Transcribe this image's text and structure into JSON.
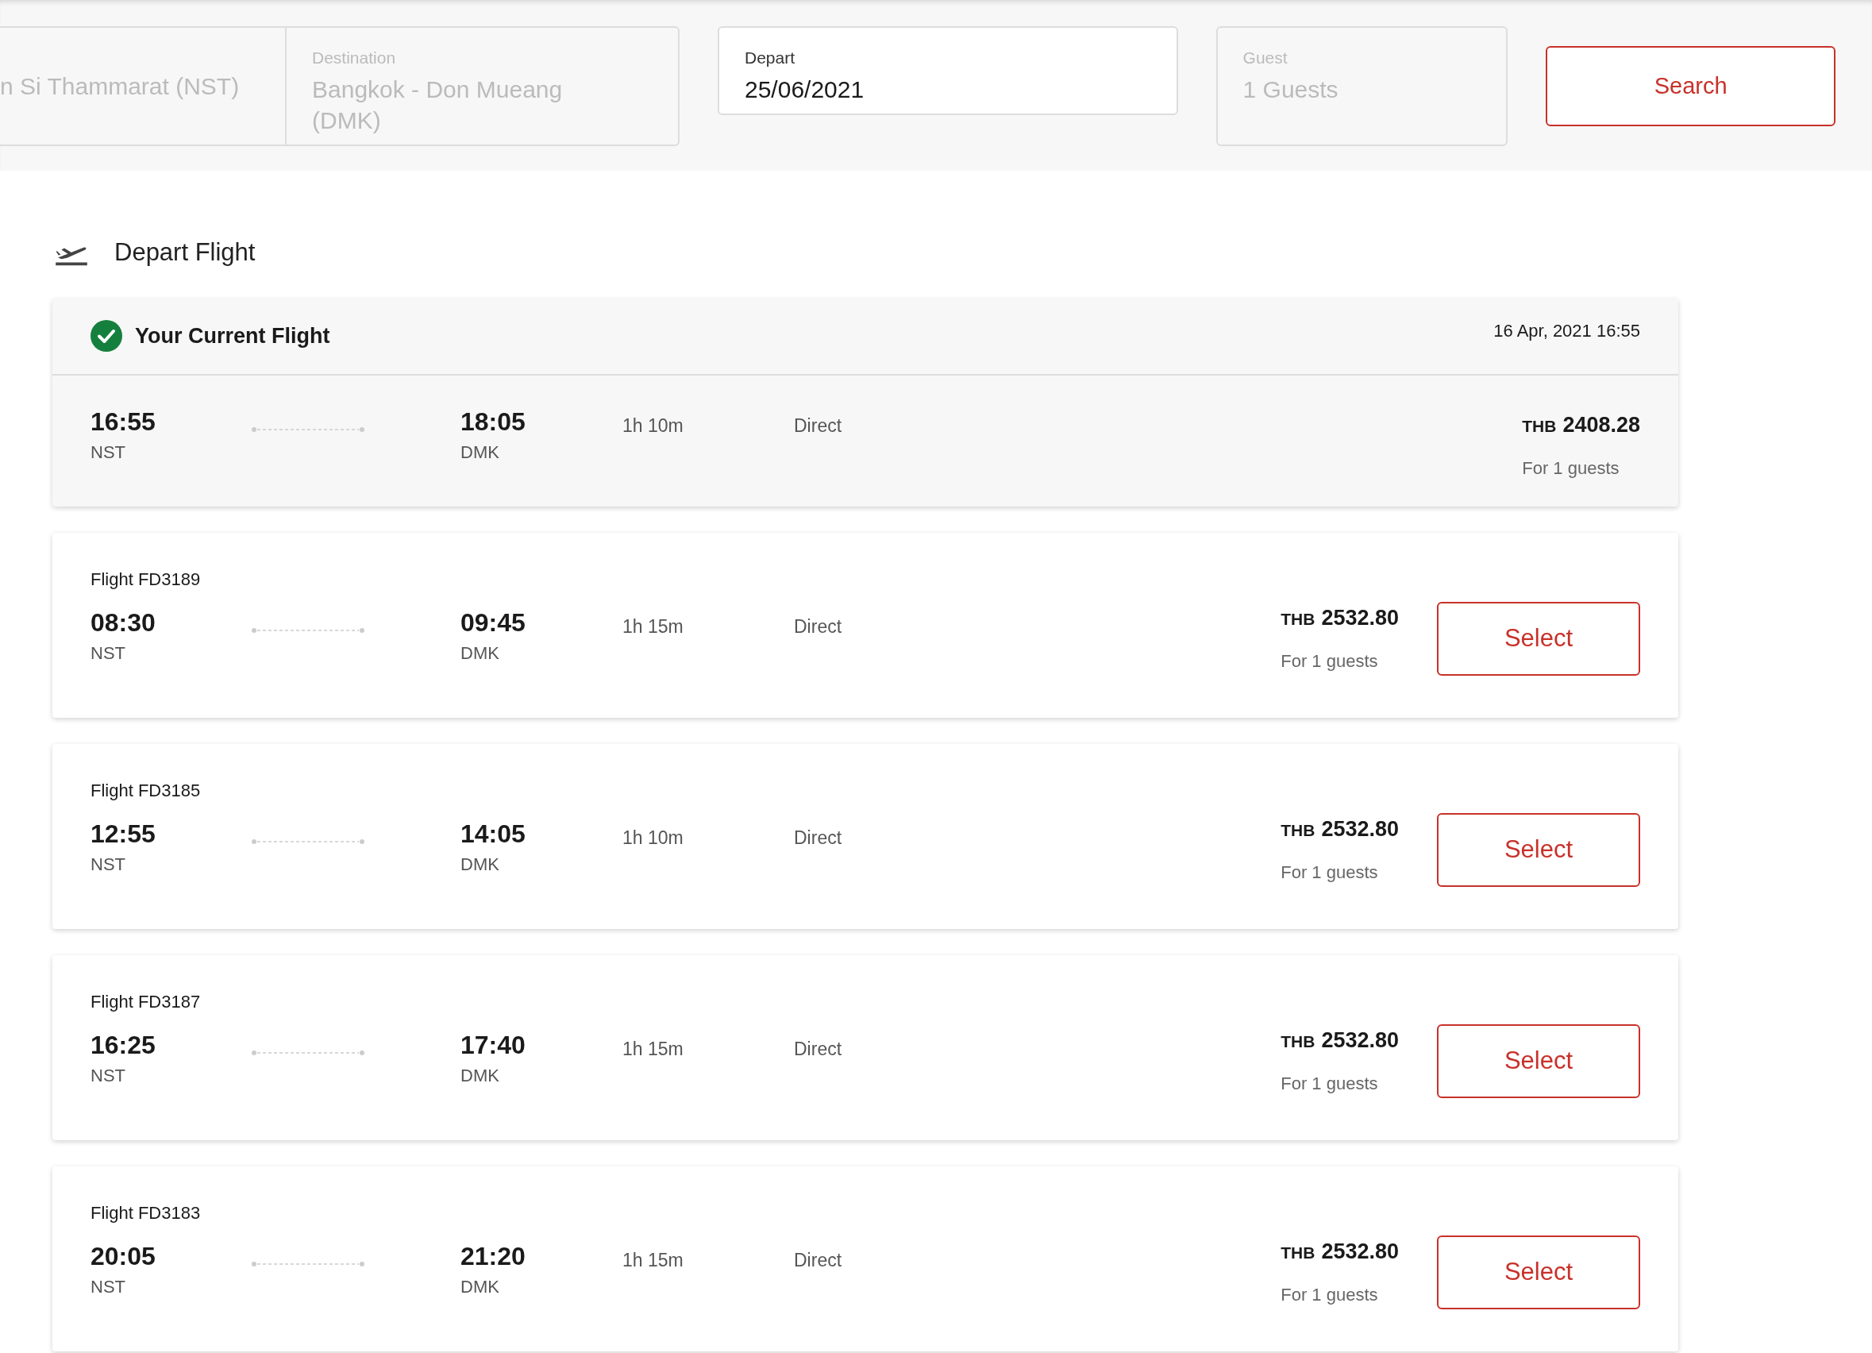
{
  "search_bar": {
    "fields": [
      {
        "kind": "cut",
        "value": "n Si Thammarat (NST)",
        "disabled": true
      },
      {
        "kind": "labeled",
        "label": "Destination",
        "value": "Bangkok - Don Mueang (DMK)",
        "disabled": true
      },
      {
        "kind": "labeled",
        "label": "Depart",
        "value": "25/06/2021",
        "disabled": false
      },
      {
        "kind": "labeled",
        "label": "Guest",
        "value": "1 Guests",
        "disabled": true
      }
    ],
    "search_button": "Search"
  },
  "section_title": "Depart Flight",
  "current_flight": {
    "title": "Your Current Flight",
    "booked_at": "16 Apr, 2021 16:55",
    "depart_time": "16:55",
    "depart_code": "NST",
    "arrive_time": "18:05",
    "arrive_code": "DMK",
    "duration": "1h 10m",
    "stops": "Direct",
    "currency": "THB",
    "price": "2408.28",
    "guests": "For 1 guests"
  },
  "flights": [
    {
      "flight_no": "Flight FD3189",
      "depart_time": "08:30",
      "depart_code": "NST",
      "arrive_time": "09:45",
      "arrive_code": "DMK",
      "duration": "1h 15m",
      "stops": "Direct",
      "currency": "THB",
      "price": "2532.80",
      "guests": "For 1 guests",
      "button": "Select"
    },
    {
      "flight_no": "Flight FD3185",
      "depart_time": "12:55",
      "depart_code": "NST",
      "arrive_time": "14:05",
      "arrive_code": "DMK",
      "duration": "1h 10m",
      "stops": "Direct",
      "currency": "THB",
      "price": "2532.80",
      "guests": "For 1 guests",
      "button": "Select"
    },
    {
      "flight_no": "Flight FD3187",
      "depart_time": "16:25",
      "depart_code": "NST",
      "arrive_time": "17:40",
      "arrive_code": "DMK",
      "duration": "1h 15m",
      "stops": "Direct",
      "currency": "THB",
      "price": "2532.80",
      "guests": "For 1 guests",
      "button": "Select"
    },
    {
      "flight_no": "Flight FD3183",
      "depart_time": "20:05",
      "depart_code": "NST",
      "arrive_time": "21:20",
      "arrive_code": "DMK",
      "duration": "1h 15m",
      "stops": "Direct",
      "currency": "THB",
      "price": "2532.80",
      "guests": "For 1 guests",
      "button": "Select"
    }
  ]
}
